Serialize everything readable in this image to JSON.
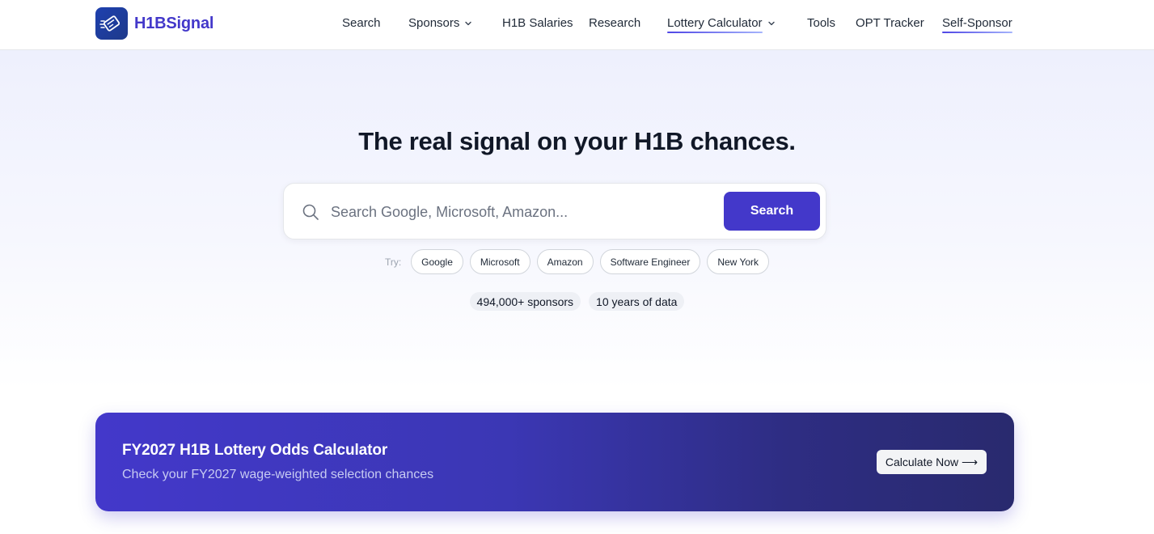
{
  "brand": {
    "name": "H1BSignal"
  },
  "nav": {
    "items": [
      {
        "label": "Search"
      },
      {
        "label": "Sponsors"
      },
      {
        "label": "H1B Salaries"
      },
      {
        "label": "Research"
      },
      {
        "label": "Lottery Calculator"
      },
      {
        "label": "Tools"
      },
      {
        "label": "OPT Tracker"
      },
      {
        "label": "Self-Sponsor"
      }
    ]
  },
  "hero": {
    "title": "The real signal on your H1B chances.",
    "search": {
      "placeholder": "Search Google, Microsoft, Amazon...",
      "value": "",
      "button_label": "Search"
    },
    "try_label": "Try:",
    "suggestions": [
      "Google",
      "Microsoft",
      "Amazon",
      "Software Engineer",
      "New York"
    ],
    "stats": [
      "494,000+ sponsors",
      "10 years of data"
    ]
  },
  "promo": {
    "title": "FY2027 H1B Lottery Odds Calculator",
    "subtitle": "Check your FY2027 wage-weighted selection chances",
    "button_label": "Calculate Now ⟶"
  },
  "colors": {
    "brand": "#4338ca",
    "logo_bg": "#1e40af",
    "promo_end": "#292a6e"
  },
  "icons": {
    "logo": "visa-card-icon",
    "search": "search-icon",
    "dropdown": "chevron-down-icon"
  }
}
